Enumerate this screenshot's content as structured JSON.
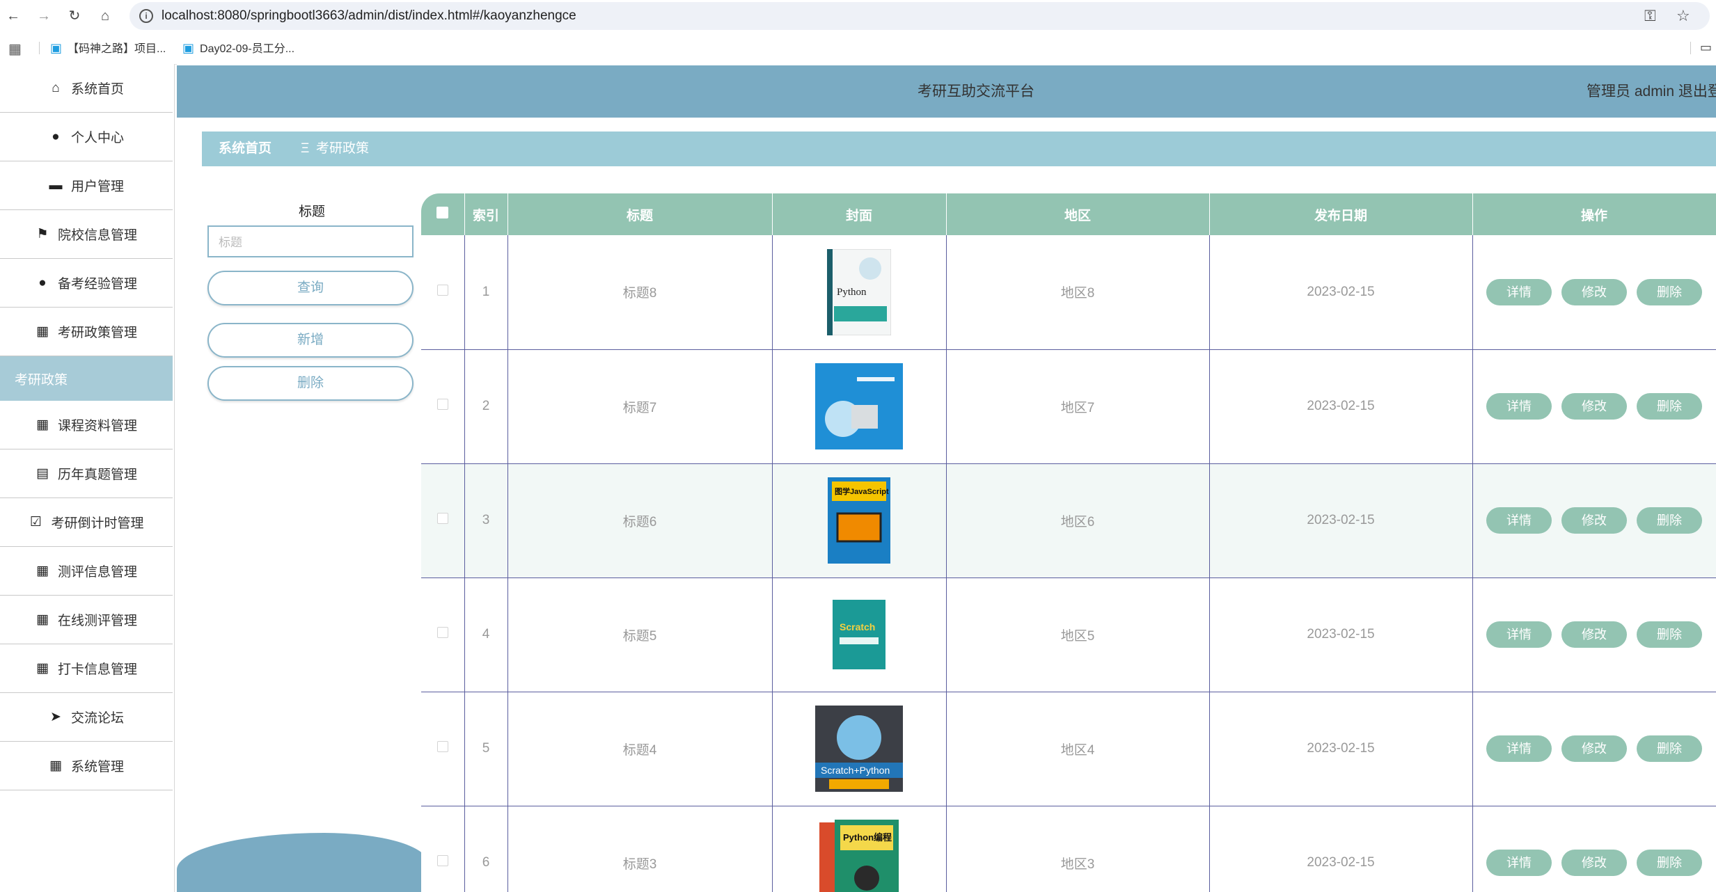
{
  "browser": {
    "url": "localhost:8080/springbootl3663/admin/dist/index.html#/kaoyanzhengce",
    "bookmarks": [
      "【码神之路】项目...",
      "Day02-09-员工分..."
    ]
  },
  "header": {
    "title": "考研互助交流平台",
    "user": "管理员 admin  退出登"
  },
  "sidebar": {
    "items": [
      {
        "label": "系统首页",
        "icon": "home-icon"
      },
      {
        "label": "个人中心",
        "icon": "user-icon"
      },
      {
        "label": "用户管理",
        "icon": "monitor-icon"
      },
      {
        "label": "院校信息管理",
        "icon": "flag-icon"
      },
      {
        "label": "备考经验管理",
        "icon": "user-icon"
      },
      {
        "label": "考研政策管理",
        "icon": "grid-icon"
      },
      {
        "label": "考研政策",
        "sub": true
      },
      {
        "label": "课程资料管理",
        "icon": "grid-icon"
      },
      {
        "label": "历年真题管理",
        "icon": "clipboard-icon"
      },
      {
        "label": "考研倒计时管理",
        "icon": "checklist-icon"
      },
      {
        "label": "测评信息管理",
        "icon": "apps-icon"
      },
      {
        "label": "在线测评管理",
        "icon": "grid-icon"
      },
      {
        "label": "打卡信息管理",
        "icon": "grid-icon"
      },
      {
        "label": "交流论坛",
        "icon": "send-icon"
      },
      {
        "label": "系统管理",
        "icon": "grid-icon"
      }
    ]
  },
  "breadcrumb": {
    "home": "系统首页",
    "separator": "Ξ",
    "current": "考研政策"
  },
  "search": {
    "label": "标题",
    "placeholder": "标题",
    "query_label": "查询",
    "add_label": "新增",
    "delete_label": "删除"
  },
  "table": {
    "headers": [
      "索引",
      "标题",
      "封面",
      "地区",
      "发布日期",
      "操作"
    ],
    "actions": [
      "详情",
      "修改",
      "删除"
    ],
    "rows": [
      {
        "index": "1",
        "title": "标题8",
        "region": "地区8",
        "date": "2023-02-15",
        "cover_text": "Python"
      },
      {
        "index": "2",
        "title": "标题7",
        "region": "地区7",
        "date": "2023-02-15",
        "cover_text": ""
      },
      {
        "index": "3",
        "title": "标题6",
        "region": "地区6",
        "date": "2023-02-15",
        "cover_text": "图学JavaScript"
      },
      {
        "index": "4",
        "title": "标题5",
        "region": "地区5",
        "date": "2023-02-15",
        "cover_text": "Scratch"
      },
      {
        "index": "5",
        "title": "标题4",
        "region": "地区4",
        "date": "2023-02-15",
        "cover_text": "Scratch+Python"
      },
      {
        "index": "6",
        "title": "标题3",
        "region": "地区3",
        "date": "2023-02-15",
        "cover_text": "Python编程"
      }
    ]
  }
}
